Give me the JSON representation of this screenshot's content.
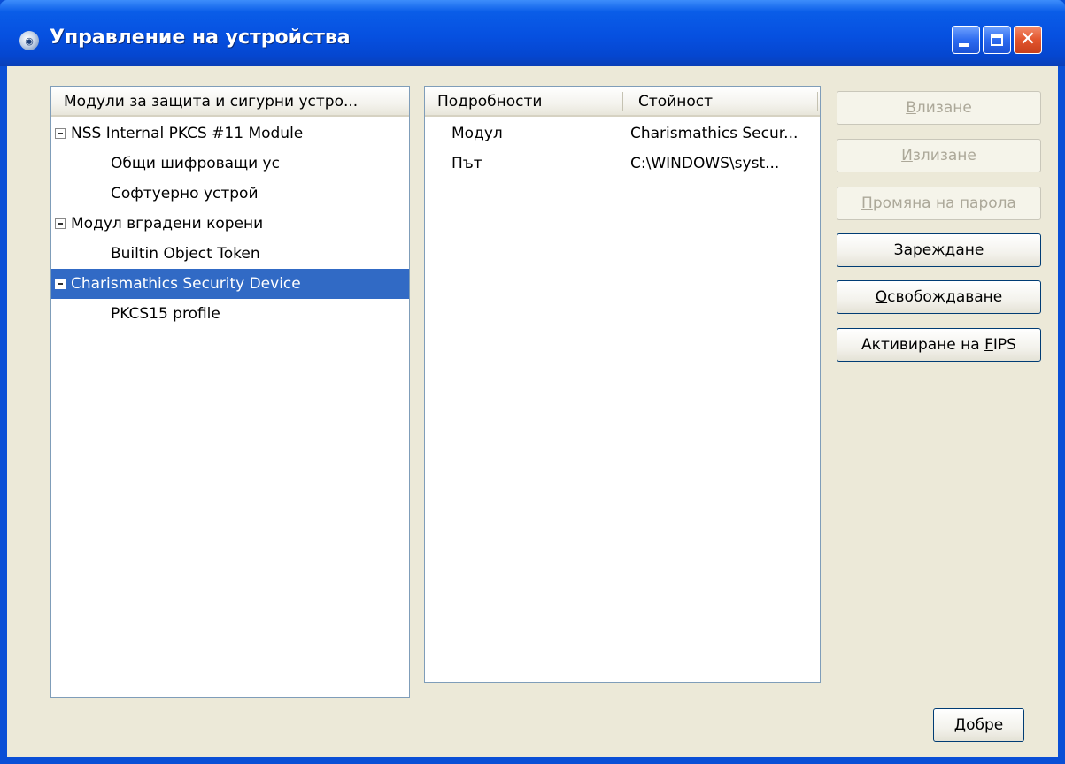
{
  "window": {
    "title": "Управление на устройства"
  },
  "tree": {
    "header": "Модули за защита и сигурни устро...",
    "rows": [
      {
        "label": "NSS Internal PKCS #11 Module",
        "level": 0,
        "expanded": true,
        "selected": false
      },
      {
        "label": "Общи шифроващи ус",
        "level": 1,
        "selected": false
      },
      {
        "label": "Софтуерно устрой",
        "level": 1,
        "selected": false
      },
      {
        "label": "Модул вградени корени",
        "level": 0,
        "expanded": true,
        "selected": false
      },
      {
        "label": "Builtin Object Token",
        "level": 1,
        "selected": false
      },
      {
        "label": "Charismathics Security Device",
        "level": 0,
        "expanded": true,
        "selected": true
      },
      {
        "label": "PKCS15 profile",
        "level": 1,
        "selected": false
      }
    ]
  },
  "details": {
    "headers": [
      "Подробности",
      "Стойност"
    ],
    "rows": [
      {
        "name": "Модул",
        "value": "Charismathics Secur..."
      },
      {
        "name": "Път",
        "value": "C:\\WINDOWS\\syst..."
      }
    ]
  },
  "buttons": {
    "login": {
      "pre": "",
      "key": "В",
      "post": "лизане",
      "enabled": false
    },
    "logout": {
      "pre": "",
      "key": "И",
      "post": "злизане",
      "enabled": false
    },
    "change_password": {
      "pre": "",
      "key": "П",
      "post": "ромяна на парола",
      "enabled": false
    },
    "load": {
      "pre": "",
      "key": "З",
      "post": "ареждане",
      "enabled": true
    },
    "unload": {
      "pre": "",
      "key": "О",
      "post": "свобождаване",
      "enabled": true
    },
    "enable_fips": {
      "pre": "Активиране на ",
      "key": "F",
      "post": "IPS",
      "enabled": true
    },
    "ok": {
      "pre": "",
      "key": "Д",
      "post": "обре",
      "enabled": true
    }
  },
  "colors": {
    "titlebar": "#0650e0",
    "selection": "#316ac5",
    "dialog_background": "#ece9d8"
  }
}
